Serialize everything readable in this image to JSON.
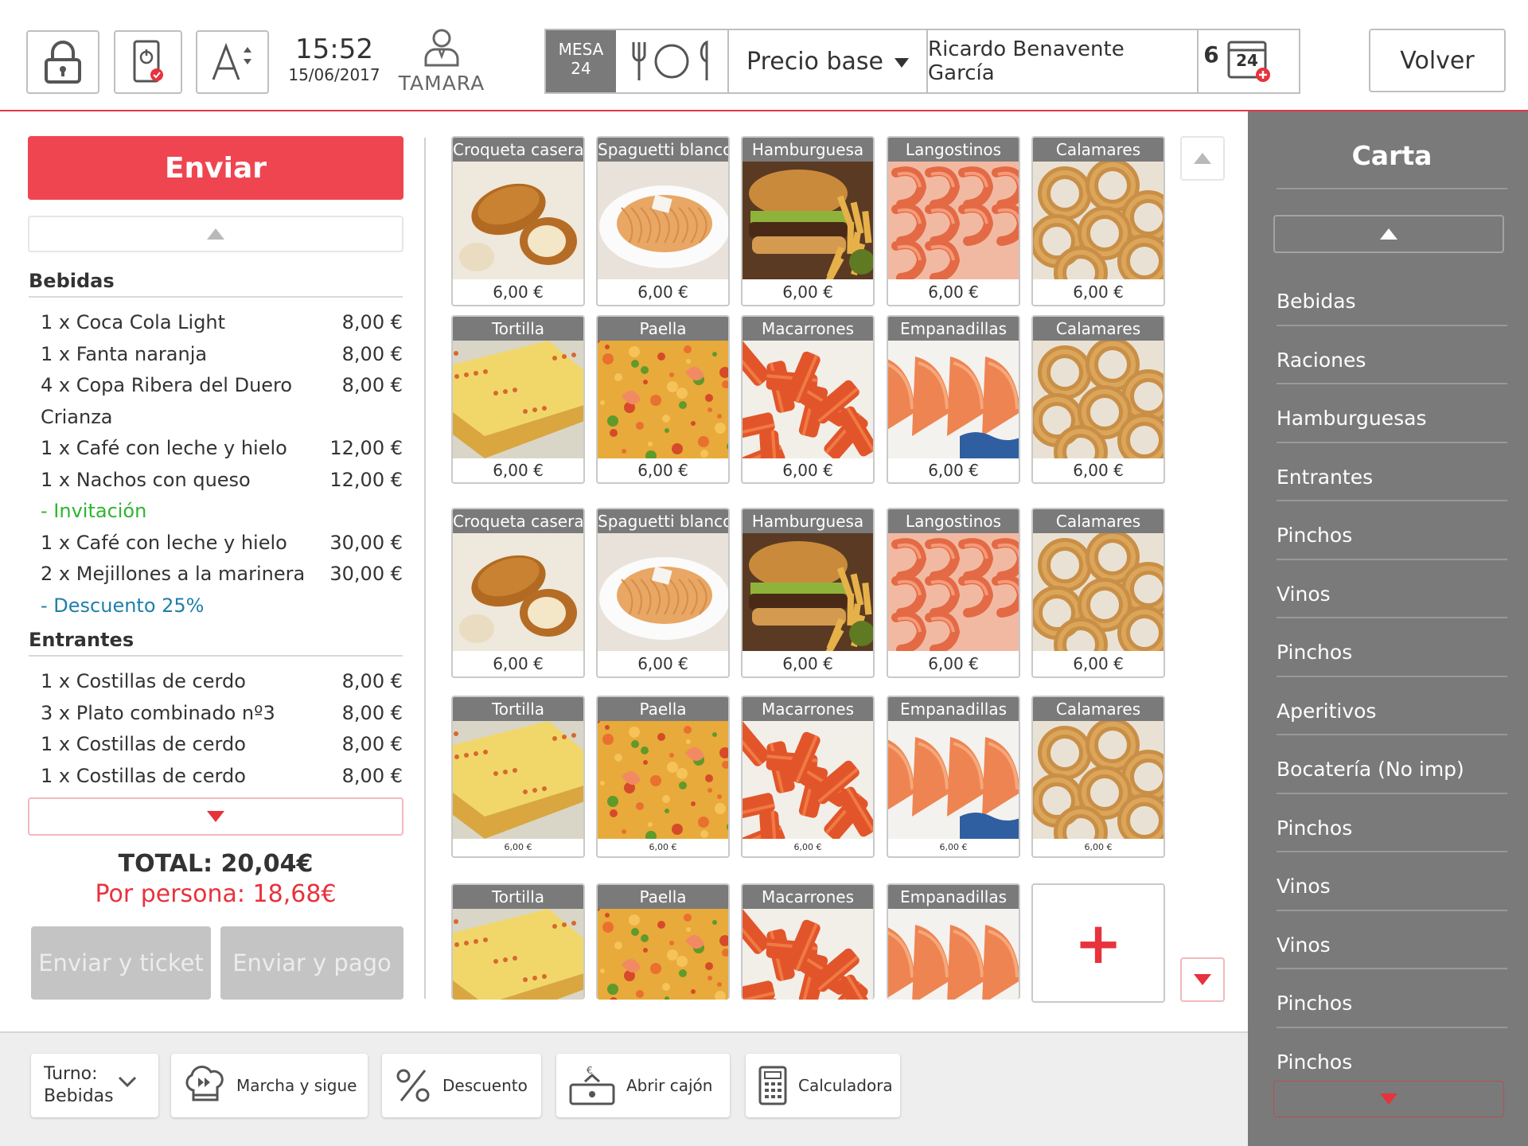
{
  "header": {
    "time": "15:52",
    "date": "15/06/2017",
    "user_name": "TAMARA",
    "mesa_label": "MESA",
    "mesa_number": "24",
    "diners": "6",
    "price_mode": "Precio base",
    "client_name": "Ricardo Benavente García",
    "calendar_day": "24",
    "back_label": "Volver",
    "icons": [
      "lock-icon",
      "terminal-check-icon",
      "font-size-icon",
      "user-icon",
      "cutlery-icon",
      "calendar-add-icon"
    ]
  },
  "order": {
    "send_label": "Enviar",
    "categories": [
      {
        "name": "Bebidas",
        "lines": [
          {
            "desc": "1 x Coca Cola Light",
            "price": "8,00 €"
          },
          {
            "desc": "1 x Fanta naranja",
            "price": "8,00 €"
          },
          {
            "desc": "4 x Copa Ribera del Duero",
            "price": "8,00 €"
          },
          {
            "desc": "Crianza",
            "price": ""
          },
          {
            "desc": "1 x Café con leche y hielo",
            "price": "12,00 €"
          },
          {
            "desc": "1 x Nachos con queso",
            "price": "12,00 €"
          },
          {
            "modifier": "- Invitación",
            "color": "#2fb52f"
          },
          {
            "desc": "1 x Café con leche y hielo",
            "price": "30,00 €"
          },
          {
            "desc": "2 x Mejillones a la marinera",
            "price": "30,00 €"
          },
          {
            "modifier": "- Descuento 25%",
            "color": "#1f7fa8"
          }
        ]
      },
      {
        "name": "Entrantes",
        "lines": [
          {
            "desc": "1 x Costillas de cerdo",
            "price": "8,00 €"
          },
          {
            "desc": "3 x Plato combinado nº3",
            "price": "8,00 €"
          },
          {
            "desc": "1 x Costillas de cerdo",
            "price": "8,00 €"
          },
          {
            "desc": "1 x Costillas de cerdo",
            "price": "8,00 €"
          }
        ]
      }
    ],
    "total": "TOTAL: 20,04€",
    "per_person": "Por persona: 18,68€",
    "send_ticket_label": "Enviar y ticket",
    "send_pay_label": "Enviar y pago"
  },
  "products": {
    "rows": [
      [
        {
          "name": "Croqueta casera",
          "price": "6,00 €",
          "img": "croqueta"
        },
        {
          "name": "Spaguetti blanco",
          "price": "6,00 €",
          "img": "spaguetti"
        },
        {
          "name": "Hamburguesa",
          "price": "6,00 €",
          "img": "hamburguesa"
        },
        {
          "name": "Langostinos",
          "price": "6,00 €",
          "img": "langostinos"
        },
        {
          "name": "Calamares",
          "price": "6,00 €",
          "img": "calamares"
        }
      ],
      [
        {
          "name": "Tortilla",
          "price": "6,00 €",
          "img": "tortilla"
        },
        {
          "name": "Paella",
          "price": "6,00 €",
          "img": "paella"
        },
        {
          "name": "Macarrones",
          "price": "6,00 €",
          "img": "macarrones"
        },
        {
          "name": "Empanadillas",
          "price": "6,00 €",
          "img": "empanadillas"
        },
        {
          "name": "Calamares",
          "price": "6,00 €",
          "img": "calamares"
        }
      ],
      [
        {
          "name": "Croqueta casera",
          "price": "6,00 €",
          "img": "croqueta"
        },
        {
          "name": "Spaguetti blanco",
          "price": "6,00 €",
          "img": "spaguetti"
        },
        {
          "name": "Hamburguesa",
          "price": "6,00 €",
          "img": "hamburguesa"
        },
        {
          "name": "Langostinos",
          "price": "6,00 €",
          "img": "langostinos"
        },
        {
          "name": "Calamares",
          "price": "6,00 €",
          "img": "calamares"
        }
      ],
      [
        {
          "name": "Tortilla",
          "price": "6,00 €",
          "img": "tortilla"
        },
        {
          "name": "Paella",
          "price": "6,00 €",
          "img": "paella"
        },
        {
          "name": "Macarrones",
          "price": "6,00 €",
          "img": "macarrones"
        },
        {
          "name": "Empanadillas",
          "price": "6,00 €",
          "img": "empanadillas"
        },
        {
          "name": "Calamares",
          "price": "6,00 €",
          "img": "calamares"
        }
      ],
      [
        {
          "name": "Tortilla",
          "price": "",
          "img": "tortilla"
        },
        {
          "name": "Paella",
          "price": "",
          "img": "paella"
        },
        {
          "name": "Macarrones",
          "price": "",
          "img": "macarrones"
        },
        {
          "name": "Empanadillas",
          "price": "",
          "img": "empanadillas"
        }
      ]
    ],
    "add_label": "+"
  },
  "carta": {
    "title": "Carta",
    "items": [
      "Bebidas",
      "Raciones",
      "Hamburguesas",
      "Entrantes",
      "Pinchos",
      "Vinos",
      "Pinchos",
      "Aperitivos",
      "Bocatería (No imp)",
      "Pinchos",
      "Vinos",
      "Vinos",
      "Pinchos",
      "Pinchos"
    ]
  },
  "footer": {
    "turno_label": "Turno:",
    "turno_value": "Bebidas",
    "marcha_label": "Marcha y sigue",
    "descuento_label": "Descuento",
    "cajon_label": "Abrir cajón",
    "calc_label": "Calculadora"
  },
  "colors": {
    "accent_red": "#ef4551",
    "header_gray": "#7a7a7a",
    "invitation_green": "#2fb52f",
    "discount_blue": "#1f7fa8"
  }
}
